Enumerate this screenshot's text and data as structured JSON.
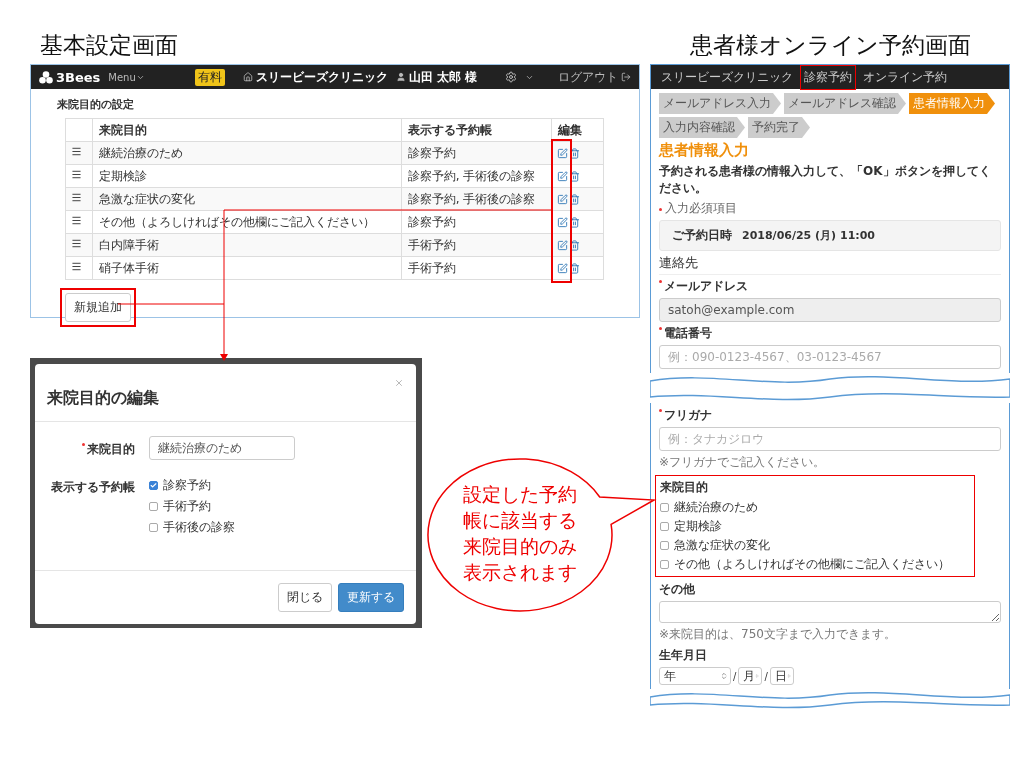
{
  "admin": {
    "title": "基本設定画面",
    "navbar": {
      "logo": "3Bees",
      "menu": "Menu",
      "badge": "有料",
      "clinic": "スリービーズクリニック",
      "user": "山田 太郎 様",
      "logout": "ログアウト"
    },
    "heading": "来院目的の設定",
    "table": {
      "columns": [
        "来院目的",
        "表示する予約帳",
        "編集"
      ],
      "rows": [
        {
          "purpose": "継続治療のため",
          "books": "診察予約"
        },
        {
          "purpose": "定期検診",
          "books": "診察予約, 手術後の診察"
        },
        {
          "purpose": "急激な症状の変化",
          "books": "診察予約, 手術後の診察"
        },
        {
          "purpose": "その他（よろしければその他欄にご記入ください）",
          "books": "診察予約"
        },
        {
          "purpose": "白内障手術",
          "books": "手術予約"
        },
        {
          "purpose": "硝子体手術",
          "books": "手術予約"
        }
      ]
    },
    "add_button": "新規追加"
  },
  "modal": {
    "title": "来院目的の編集",
    "fields": [
      {
        "kind": "input",
        "label": "来院目的",
        "required": true,
        "value": "継続治療のため"
      },
      {
        "kind": "checkboxes",
        "label": "表示する予約帳",
        "required": false,
        "options": [
          {
            "label": "診察予約",
            "checked": true
          },
          {
            "label": "手術予約",
            "checked": false
          },
          {
            "label": "手術後の診察",
            "checked": false
          }
        ]
      }
    ],
    "buttons": [
      {
        "label": "閉じる",
        "primary": false
      },
      {
        "label": "更新する",
        "primary": true
      }
    ]
  },
  "patient": {
    "title": "患者様オンライン予約画面",
    "nav": [
      {
        "label": "スリービーズクリニック",
        "highlighted": false
      },
      {
        "label": "診察予約",
        "highlighted": true
      },
      {
        "label": "オンライン予約",
        "highlighted": false
      }
    ],
    "steps": [
      {
        "label": "メールアドレス入力",
        "active": false
      },
      {
        "label": "メールアドレス確認",
        "active": false
      },
      {
        "label": "患者情報入力",
        "active": true
      },
      {
        "label": "入力内容確認",
        "active": false
      },
      {
        "label": "予約完了",
        "active": false
      }
    ],
    "heading": "患者情報入力",
    "instruction": "予約される患者様の情報入力して、「OK」ボタンを押してください。",
    "required_note": "入力必須項目",
    "appointment": {
      "label": "ご予約日時",
      "value": "2018/06/25 (月) 11:00"
    },
    "section": "連絡先",
    "fields_top": [
      {
        "kind": "input",
        "label": "メールアドレス",
        "required": true,
        "value": "satoh@example.com",
        "disabled": true
      },
      {
        "kind": "input",
        "label": "電話番号",
        "required": true,
        "placeholder": "例：090-0123-4567、03-0123-4567",
        "disabled": false
      }
    ],
    "fields_bottom": [
      {
        "kind": "input",
        "label": "フリガナ",
        "required": true,
        "placeholder": "例：タナカジロウ",
        "disabled": false,
        "help": "※フリガナでご記入ください。"
      },
      {
        "kind": "checkboxes",
        "label": "来院目的",
        "required": false,
        "highlighted": true,
        "options": [
          {
            "label": "継続治療のため",
            "checked": false
          },
          {
            "label": "定期検診",
            "checked": false
          },
          {
            "label": "急激な症状の変化",
            "checked": false
          },
          {
            "label": "その他（よろしければその他欄にご記入ください）",
            "checked": false
          }
        ]
      },
      {
        "kind": "textarea",
        "label": "その他",
        "required": false,
        "help": "※来院目的は、750文字まで入力できます。"
      },
      {
        "kind": "selects",
        "label": "生年月日",
        "required": false,
        "options": [
          "年",
          "月",
          "日"
        ],
        "separator": "/"
      }
    ]
  },
  "callout": {
    "text": "設定した予約帳に該当する来院目的のみ表示されます"
  }
}
